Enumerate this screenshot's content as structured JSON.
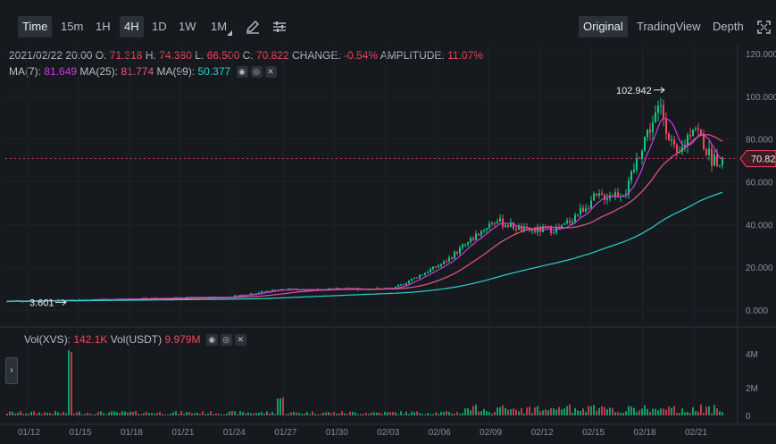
{
  "toolbar": {
    "intervals": [
      "Time",
      "15m",
      "1H",
      "4H",
      "1D",
      "1W",
      "1M"
    ],
    "active_intervals": [
      "Time",
      "4H"
    ],
    "views": [
      "Original",
      "TradingView",
      "Depth"
    ],
    "active_view": "Original"
  },
  "ohlc": {
    "datetime": "2021/02/22 20:00",
    "o_label": "O:",
    "o": "71.318",
    "h_label": "H:",
    "h": "74.380",
    "l_label": "L:",
    "l": "66.500",
    "c_label": "C:",
    "c": "70.822",
    "change_label": "CHANGE:",
    "change": "-0.54%",
    "amplitude_label": "AMPLITUDE:",
    "amplitude": "11.07%"
  },
  "ma": {
    "ma7_label": "MA(7):",
    "ma7": "81.649",
    "ma25_label": "MA(25):",
    "ma25": "81.774",
    "ma99_label": "MA(99):",
    "ma99": "50.377"
  },
  "volume": {
    "vol_xvs_label": "Vol(XVS):",
    "vol_xvs": "142.1K",
    "vol_usdt_label": "Vol(USDT)",
    "vol_usdt": "9.979M"
  },
  "chart_data": {
    "type": "candlestick",
    "price_axis_ticks": [
      "120.000",
      "100.000",
      "80.000",
      "60.000",
      "40.000",
      "20.000",
      "0.000"
    ],
    "volume_axis_ticks": [
      "4M",
      "2M",
      "0"
    ],
    "date_ticks": [
      "01/12",
      "01/15",
      "01/18",
      "01/21",
      "01/24",
      "01/27",
      "01/30",
      "02/03",
      "02/06",
      "02/09",
      "02/12",
      "02/15",
      "02/18",
      "02/21"
    ],
    "high_annotation": "102.942",
    "low_annotation": "3.601",
    "last_price": "70.822",
    "ylim": [
      0,
      120
    ],
    "price_trend": [
      {
        "date": "01/10",
        "close": 4.0
      },
      {
        "date": "01/24",
        "close": 6.0
      },
      {
        "date": "01/27",
        "close": 9.5
      },
      {
        "date": "02/03",
        "close": 10.0
      },
      {
        "date": "02/06",
        "close": 22.0
      },
      {
        "date": "02/09",
        "close": 42.0
      },
      {
        "date": "02/11",
        "close": 37.0
      },
      {
        "date": "02/13",
        "close": 38.0
      },
      {
        "date": "02/15",
        "close": 52.0
      },
      {
        "date": "02/17",
        "close": 56.0
      },
      {
        "date": "02/18",
        "close": 80.0
      },
      {
        "date": "02/19",
        "close": 95.0
      },
      {
        "date": "02/20",
        "close": 70.0
      },
      {
        "date": "02/21",
        "close": 88.0
      },
      {
        "date": "02/22",
        "close": 70.8
      }
    ],
    "ma_colors": {
      "ma7": "#c93ce6",
      "ma25": "#e8548a",
      "ma99": "#2bd0d0"
    },
    "up_color": "#0ecb81",
    "down_color": "#f6465d"
  }
}
